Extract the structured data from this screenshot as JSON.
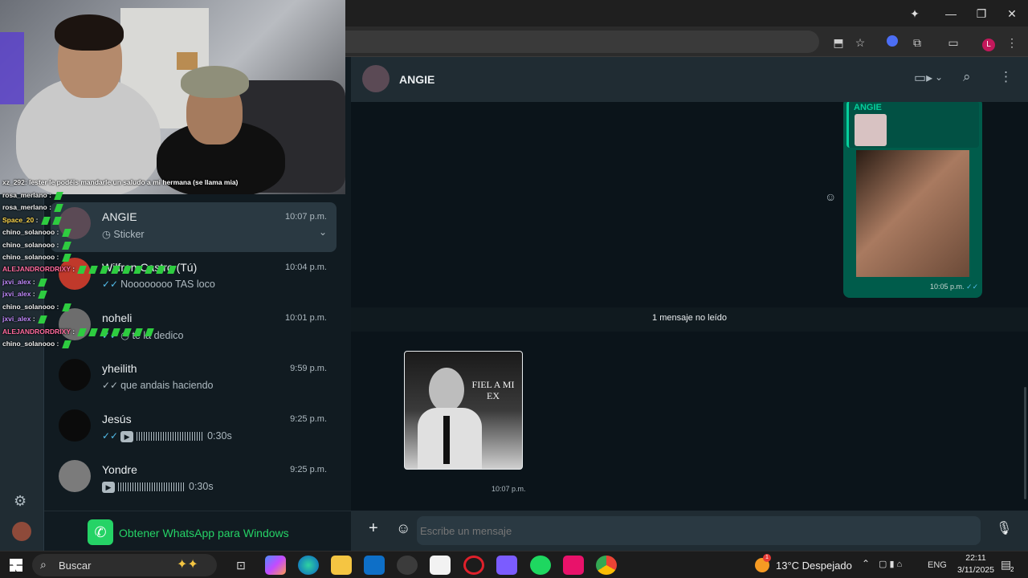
{
  "browser": {
    "copilot_icon": "sparkle-icon",
    "window_controls": [
      "minimize",
      "restore",
      "close"
    ],
    "toolbar_icons": [
      "install-icon",
      "star-icon",
      "extension-blue-icon",
      "puzzle-icon",
      "sidepanel-icon",
      "profile-icon",
      "menu-icon"
    ],
    "profile_initial": "L"
  },
  "stream_chat": [
    {
      "user": "xz_292",
      "message": "lester le podéis mandarle un saludo a mi hermana (se llama mia)"
    },
    {
      "user": "rosa_merlano",
      "message": ""
    },
    {
      "user": "rosa_merlano",
      "message": ""
    },
    {
      "user": "Space_20",
      "message": ""
    },
    {
      "user": "chino_solanooo",
      "message": ""
    },
    {
      "user": "chino_solanooo",
      "message": ""
    },
    {
      "user": "chino_solanooo",
      "message": ""
    },
    {
      "user": "ALEJANDRORDRIXY",
      "message": ""
    },
    {
      "user": "jxvi_alex",
      "message": ""
    },
    {
      "user": "jxvi_alex",
      "message": ""
    },
    {
      "user": "chino_solanooo",
      "message": ""
    },
    {
      "user": "jxvi_alex",
      "message": ""
    },
    {
      "user": "ALEJANDRORDRIXY",
      "message": ""
    },
    {
      "user": "chino_solanooo",
      "message": ""
    }
  ],
  "chats": [
    {
      "name": "ANGIE",
      "time": "10:07 p.m.",
      "preview": "Sticker",
      "active": true
    },
    {
      "name": "Wilfren Castro (Tú)",
      "time": "10:04 p.m.",
      "preview": "Noooooooo TAS loco"
    },
    {
      "name": "noheli",
      "time": "10:01 p.m.",
      "preview": "te la dedico"
    },
    {
      "name": "yheilith",
      "time": "9:59 p.m.",
      "preview": "que andais haciendo"
    },
    {
      "name": "Jesús",
      "time": "9:25 p.m.",
      "preview": "0:30s"
    },
    {
      "name": "Yondre",
      "time": "9:25 p.m.",
      "preview": "0:30s"
    }
  ],
  "get_app": {
    "label": "Obtener WhatsApp para Windows",
    "color": "#25d366"
  },
  "conversation": {
    "contact_name": "ANGIE",
    "quoted_name": "ANGIE",
    "outgoing_time": "10:05 p.m.",
    "unread_label": "1 mensaje no leído",
    "sticker_text": "FIEL A MI EX",
    "sticker_time": "10:07 p.m."
  },
  "composer": {
    "placeholder": "Escribe un mensaje"
  },
  "taskbar": {
    "search_label": "Buscar",
    "weather": "13°C Despejado",
    "weather_badge": "1",
    "language": "ENG",
    "time": "22:11",
    "date": "3/11/2025",
    "notification_count": "2"
  },
  "colors": {
    "accent": "#00a884",
    "outgoing_bubble": "#005c4b",
    "tick": "#53bdeb"
  }
}
